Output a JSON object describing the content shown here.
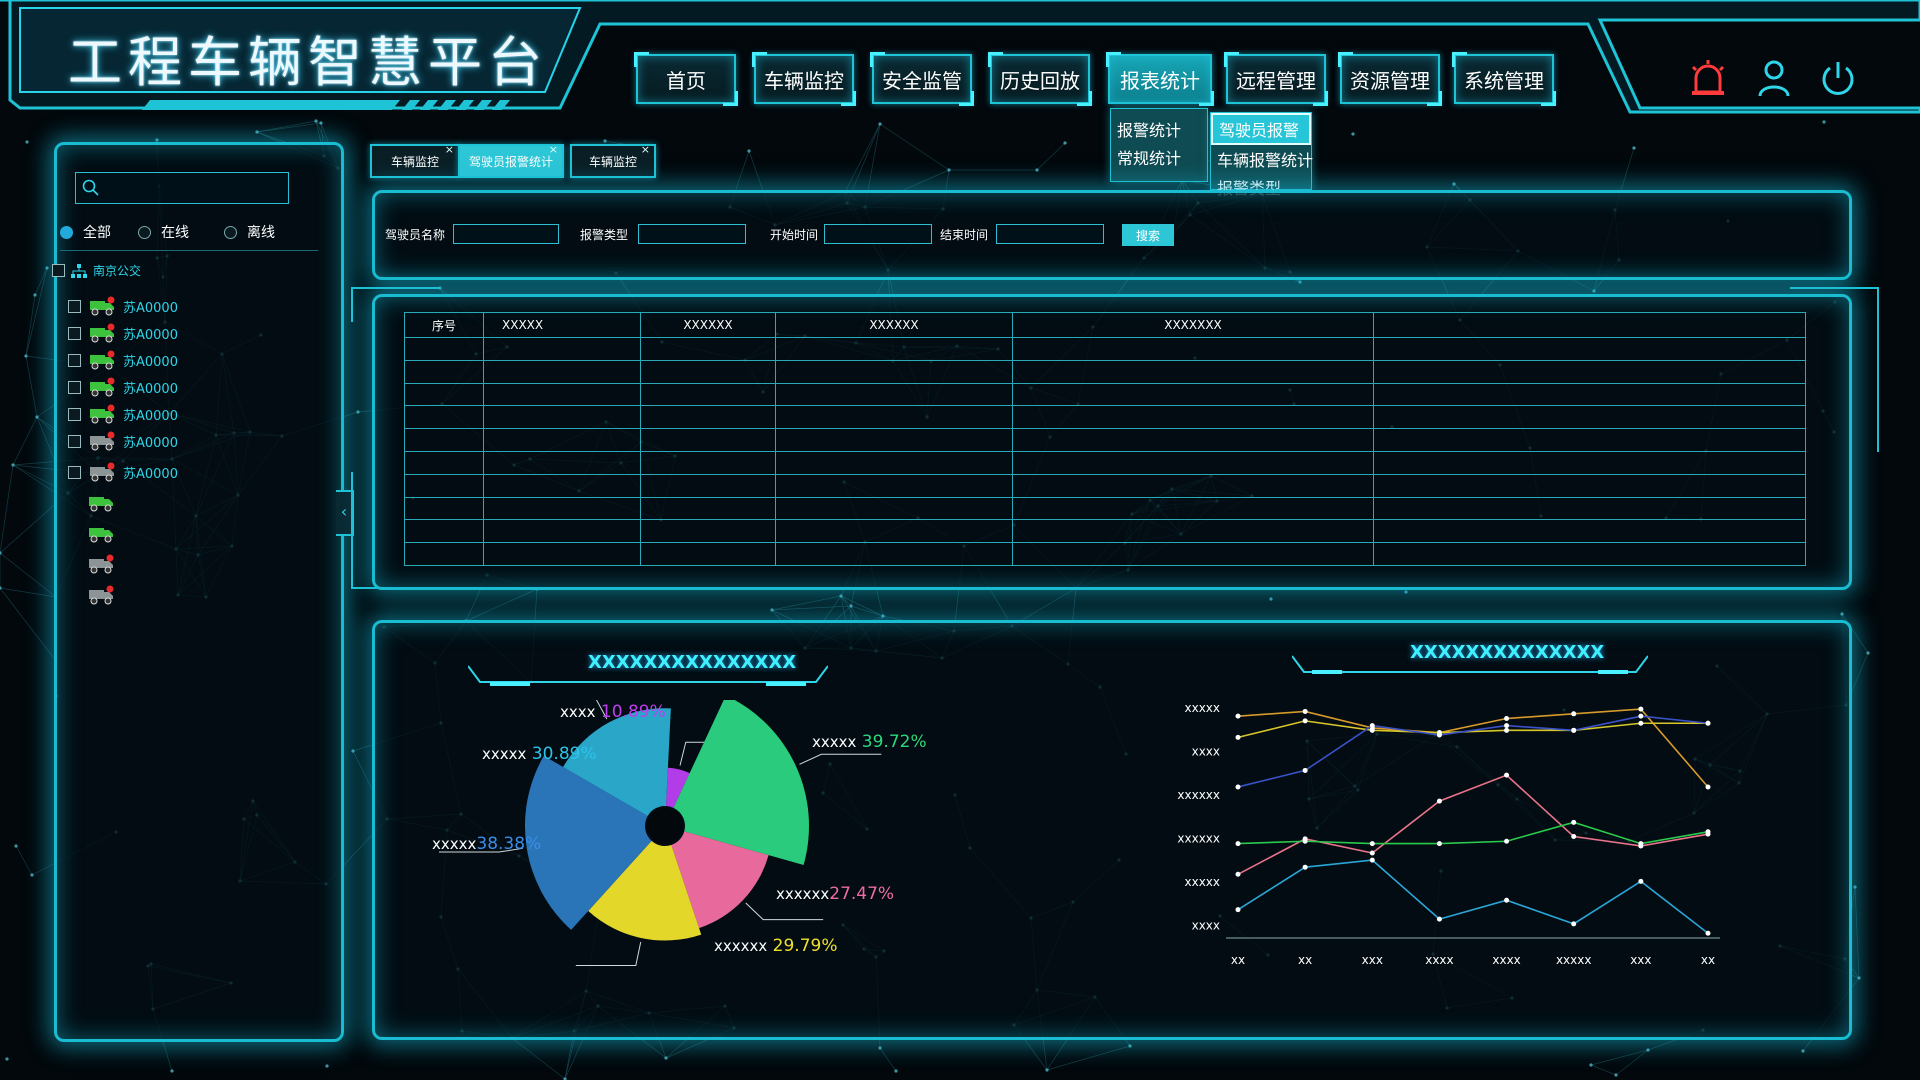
{
  "header": {
    "title": "工程车辆智慧平台",
    "nav": [
      "首页",
      "车辆监控",
      "安全监管",
      "历史回放",
      "报表统计",
      "远程管理",
      "资源管理",
      "系统管理"
    ],
    "active_nav": "报表统计",
    "dropdown_left": [
      "报警统计",
      "常规统计"
    ],
    "dropdown_right": [
      "驾驶员报警",
      "车辆报警统计",
      "报警类型"
    ],
    "icons": [
      "alarm-icon",
      "user-icon",
      "power-icon"
    ]
  },
  "subtabs": [
    {
      "label": "车辆监控",
      "close": "×"
    },
    {
      "label": "驾驶员报警统计",
      "close": "×"
    },
    {
      "label": "车辆监控",
      "close": "×"
    }
  ],
  "sidebar": {
    "filters": [
      "全部",
      "在线",
      "离线"
    ],
    "group": "南京公交",
    "vehicles": [
      "苏A0000",
      "苏A0000",
      "苏A0000",
      "苏A0000",
      "苏A0000",
      "苏A0000",
      "苏A0000"
    ],
    "collapse_arrow": "‹"
  },
  "filter_bar": {
    "driver_label": "驾驶员名称",
    "type_label": "报警类型",
    "start_label": "开始时间",
    "end_label": "结束时间",
    "search_label": "搜索"
  },
  "table": {
    "headers": [
      "序号",
      "XXXXX",
      "XXXXXX",
      "XXXXXX",
      "XXXXXXX",
      ""
    ]
  },
  "pie_chart": {
    "title": "XXXXXXXXXXXXXXX",
    "labels": [
      {
        "name": "xxxx",
        "pct": "10.89%"
      },
      {
        "name": "xxxxx",
        "pct": "39.72%"
      },
      {
        "name": "xxxxx",
        "pct": "30.89%"
      },
      {
        "name": "xxxxx",
        "pct": "38.38%"
      },
      {
        "name": "xxxxxx",
        "pct": "27.47%"
      },
      {
        "name": "xxxxxx",
        "pct": "29.79%"
      }
    ]
  },
  "line_chart": {
    "title": "XXXXXXXXXXXXXX",
    "y_labels": [
      "xxxxx",
      "xxxx",
      "xxxxxx",
      "xxxxxx",
      "xxxxx",
      "xxxx"
    ],
    "x_labels": [
      "xx",
      "xx",
      "xxx",
      "xxxx",
      "xxxx",
      "xxxxx",
      "xxx",
      "xx"
    ]
  },
  "chart_data": [
    {
      "type": "pie",
      "title": "XXXXXXXXXXXXXXX",
      "slices": [
        {
          "label": "xxxx",
          "value": 10.89,
          "color": "#b23ce8"
        },
        {
          "label": "xxxxx",
          "value": 39.72,
          "color": "#2acb7c"
        },
        {
          "label": "xxxxxx",
          "value": 27.47,
          "color": "#e8699b"
        },
        {
          "label": "xxxxxx",
          "value": 29.79,
          "color": "#e3d72a"
        },
        {
          "label": "xxxxx",
          "value": 38.38,
          "color": "#2a74b8"
        },
        {
          "label": "xxxxx",
          "value": 30.89,
          "color": "#2aa6c8"
        }
      ]
    },
    {
      "type": "line",
      "title": "XXXXXXXXXXXXXX",
      "categories": [
        "xx",
        "xx",
        "xxx",
        "xxxx",
        "xxxx",
        "xxxxx",
        "xxx",
        "xx"
      ],
      "ylim": [
        0,
        10
      ],
      "series": [
        {
          "color": "#d89a2a",
          "values": [
            9.4,
            9.6,
            8.9,
            8.7,
            9.3,
            9.5,
            9.7,
            6.4
          ]
        },
        {
          "color": "#d8c62a",
          "values": [
            8.5,
            9.2,
            8.8,
            8.7,
            8.8,
            8.8,
            9.1,
            9.1
          ]
        },
        {
          "color": "#3a52c8",
          "values": [
            6.4,
            7.1,
            9.0,
            8.6,
            9.0,
            8.8,
            9.4,
            9.1
          ]
        },
        {
          "color": "#e8738a",
          "values": [
            2.7,
            4.2,
            3.6,
            5.8,
            6.9,
            4.3,
            3.9,
            4.4
          ]
        },
        {
          "color": "#2acb4c",
          "values": [
            4.0,
            4.1,
            4.0,
            4.0,
            4.1,
            4.9,
            4.0,
            4.5
          ]
        },
        {
          "color": "#2aa6d8",
          "values": [
            1.2,
            3.0,
            3.3,
            0.8,
            1.6,
            0.6,
            2.4,
            0.2
          ]
        }
      ]
    }
  ]
}
